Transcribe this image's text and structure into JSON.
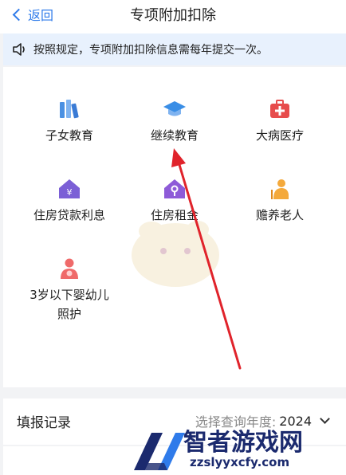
{
  "nav": {
    "back_label": "返回",
    "title": "专项附加扣除"
  },
  "notice": {
    "text": "按照规定，专项附加扣除信息需每年提交一次。"
  },
  "categories": [
    {
      "label": "子女教育",
      "icon": "books-icon"
    },
    {
      "label": "继续教育",
      "icon": "graduation-cap-icon"
    },
    {
      "label": "大病医疗",
      "icon": "medical-kit-icon"
    },
    {
      "label": "住房贷款利息",
      "icon": "house-yuan-icon"
    },
    {
      "label": "住房租金",
      "icon": "house-key-icon"
    },
    {
      "label": "赡养老人",
      "icon": "elderly-person-icon"
    },
    {
      "label": "3岁以下婴幼儿照护",
      "icon": "mother-baby-icon"
    }
  ],
  "records": {
    "title": "填报记录",
    "year_prompt": "选择查询年度:",
    "year_value": "2024"
  },
  "watermark": {
    "brand": "智者游戏网",
    "url": "zzslyyxcfy.com"
  },
  "colors": {
    "accent": "#2f7bea",
    "notice_bg": "#e8f1fd",
    "arrow": "#e0232b"
  }
}
